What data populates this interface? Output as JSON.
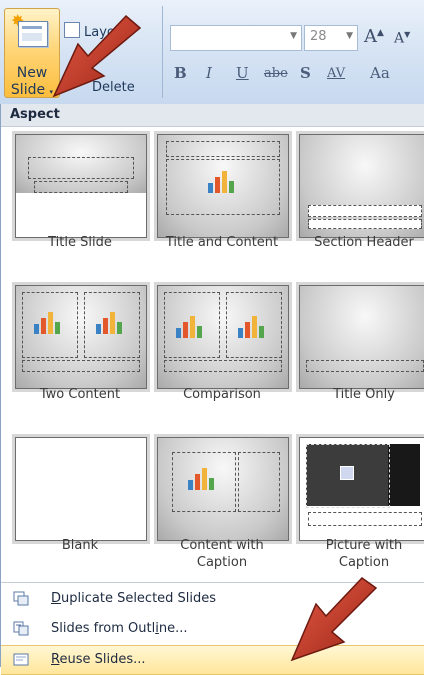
{
  "ribbon": {
    "new_slide_line1": "New",
    "new_slide_line2": "Slide",
    "dropdown_glyph": "▾",
    "layout_label": "Layout",
    "delete_label": "Delete",
    "font_size_value": "28",
    "grow_font": "A",
    "shrink_font": "A",
    "bold": "B",
    "italic": "I",
    "underline": "U",
    "strikethrough": "abe",
    "shadow": "S",
    "char_spacing": "AV",
    "change_case": "Aa"
  },
  "gallery": {
    "section_title": "Aspect",
    "layouts": [
      {
        "label": "Title Slide"
      },
      {
        "label": "Title and Content"
      },
      {
        "label": "Section Header"
      },
      {
        "label": "Two Content"
      },
      {
        "label": "Comparison"
      },
      {
        "label": "Title Only"
      },
      {
        "label": "Blank"
      },
      {
        "label": "Content with\nCaption"
      },
      {
        "label": "Picture with\nCaption"
      }
    ]
  },
  "menu": {
    "duplicate_pre": "",
    "duplicate_ul": "D",
    "duplicate_post": "uplicate Selected Slides",
    "outline_pre": "Slides from Outl",
    "outline_ul": "i",
    "outline_post": "ne...",
    "reuse_pre": "",
    "reuse_ul": "R",
    "reuse_post": "euse Slides..."
  },
  "colors": {
    "highlight": "#ffe69b",
    "arrow": "#c0392b",
    "ribbon": "#d4e2f3"
  },
  "icons": [
    "new-slide-icon",
    "layout-icon",
    "delete-icon",
    "arrow-pointer-icon",
    "duplicate-slides-icon",
    "outline-icon",
    "reuse-slides-icon"
  ]
}
